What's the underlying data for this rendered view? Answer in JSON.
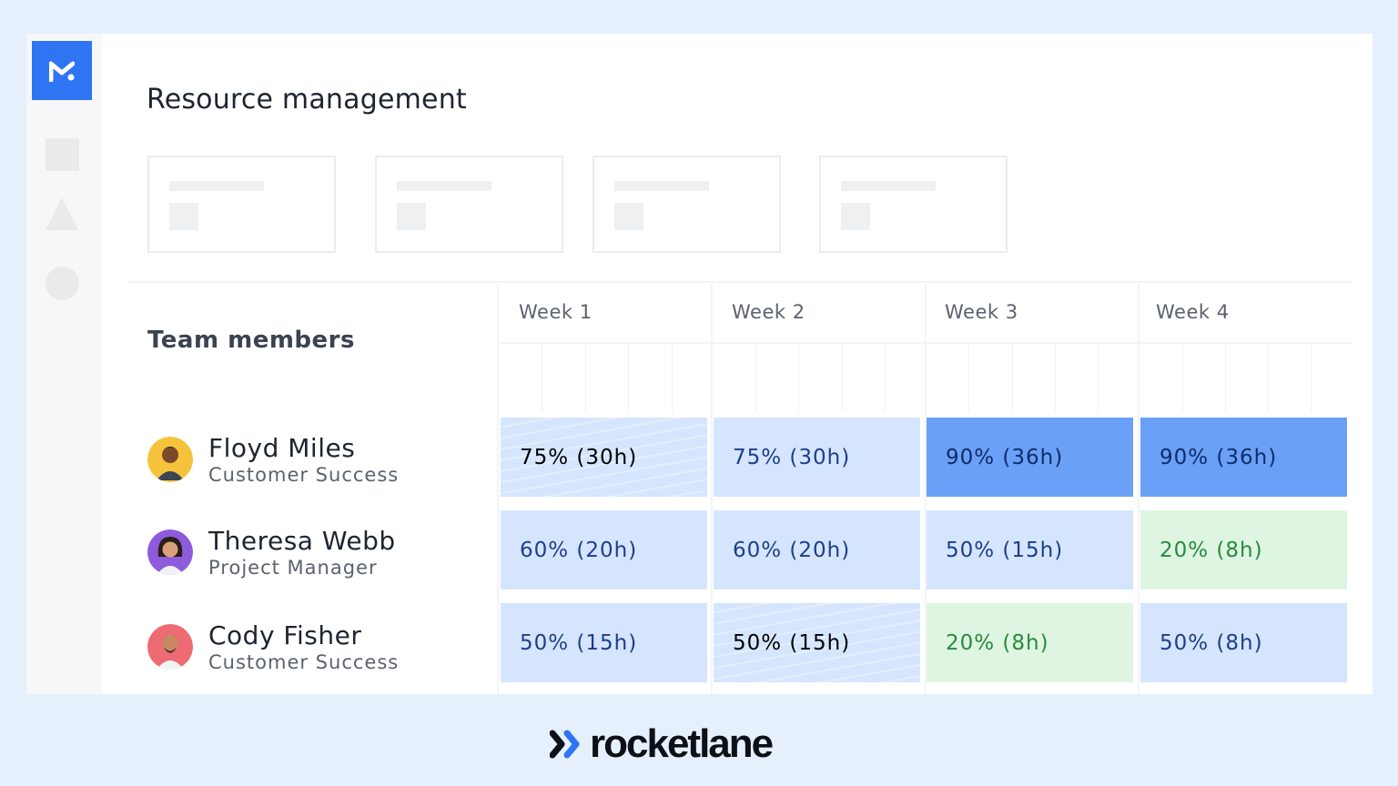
{
  "app": {
    "title": "Resource management",
    "logo_icon": "m-logo-icon",
    "accent_color": "#2f74f3"
  },
  "sidebar": {
    "items": [
      {
        "icon": "square-placeholder-icon"
      },
      {
        "icon": "triangle-placeholder-icon"
      },
      {
        "icon": "circle-placeholder-icon"
      }
    ]
  },
  "table": {
    "header": "Team members",
    "weeks": [
      "Week 1",
      "Week 2",
      "Week 3",
      "Week 4"
    ],
    "members": [
      {
        "name": "Floyd Miles",
        "role": "Customer Success",
        "avatar_color": "#f5c33b",
        "allocations": [
          {
            "label": "75% (30h)",
            "status": "light-wavy"
          },
          {
            "label": "75% (30h)",
            "status": "light"
          },
          {
            "label": "90% (36h)",
            "status": "dark"
          },
          {
            "label": "90% (36h)",
            "status": "dark"
          }
        ]
      },
      {
        "name": "Theresa Webb",
        "role": "Project Manager",
        "avatar_color": "#8e5bdc",
        "allocations": [
          {
            "label": "60% (20h)",
            "status": "light"
          },
          {
            "label": "60% (20h)",
            "status": "light"
          },
          {
            "label": "50% (15h)",
            "status": "light"
          },
          {
            "label": "20% (8h)",
            "status": "green"
          }
        ]
      },
      {
        "name": "Cody Fisher",
        "role": "Customer Success",
        "avatar_color": "#ee6b73",
        "allocations": [
          {
            "label": "50% (15h)",
            "status": "light"
          },
          {
            "label": "50% (15h)",
            "status": "light-wavy"
          },
          {
            "label": "20% (8h)",
            "status": "green"
          },
          {
            "label": "50% (8h)",
            "status": "light"
          }
        ]
      }
    ]
  },
  "colors": {
    "light": "#d5e5fd",
    "dark": "#6aa0f6",
    "green": "#def5e2"
  },
  "brand": {
    "name": "rocketlane",
    "mark_icon": "double-chevron-icon",
    "mark_color": "#2f74f3"
  }
}
